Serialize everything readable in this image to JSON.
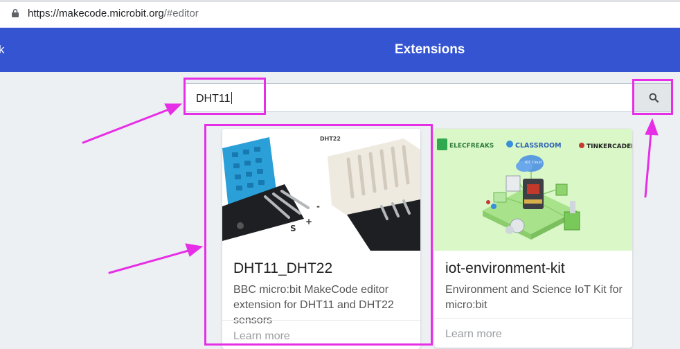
{
  "browser": {
    "url_host": "https://makecode.microbit.org",
    "url_path": "/#editor"
  },
  "header": {
    "back_label": "k",
    "title": "Extensions"
  },
  "search": {
    "value": "DHT11"
  },
  "cards": [
    {
      "name": "DHT11_DHT22",
      "description": "BBC micro:bit MakeCode editor extension for DHT11 and DHT22 sensors",
      "link": "Learn more",
      "image_caption": "DHT22",
      "pin_labels": [
        "S",
        "+",
        "-"
      ]
    },
    {
      "name": "iot-environment-kit",
      "description": "Environment and Science IoT Kit for micro:bit",
      "link": "Learn more",
      "image_logos": [
        "ELECFREAKS",
        "CLASSROOM",
        "TINKERCADEMY"
      ],
      "image_cloud_label": "IOT Cloud"
    }
  ],
  "colors": {
    "header": "#3454d1",
    "highlight": "#e62ee6",
    "card2_image_bg": "#d9f7c7"
  }
}
